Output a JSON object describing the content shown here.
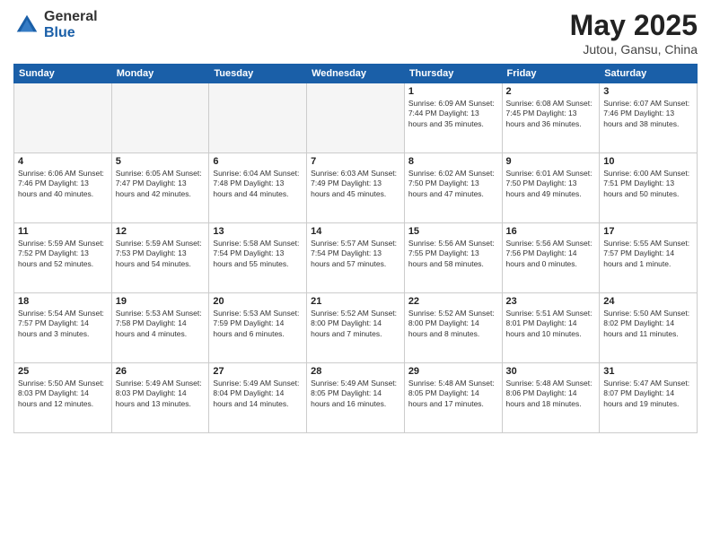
{
  "header": {
    "logo_general": "General",
    "logo_blue": "Blue",
    "month_title": "May 2025",
    "location": "Jutou, Gansu, China"
  },
  "days_of_week": [
    "Sunday",
    "Monday",
    "Tuesday",
    "Wednesday",
    "Thursday",
    "Friday",
    "Saturday"
  ],
  "weeks": [
    [
      {
        "day": "",
        "info": ""
      },
      {
        "day": "",
        "info": ""
      },
      {
        "day": "",
        "info": ""
      },
      {
        "day": "",
        "info": ""
      },
      {
        "day": "1",
        "info": "Sunrise: 6:09 AM\nSunset: 7:44 PM\nDaylight: 13 hours\nand 35 minutes."
      },
      {
        "day": "2",
        "info": "Sunrise: 6:08 AM\nSunset: 7:45 PM\nDaylight: 13 hours\nand 36 minutes."
      },
      {
        "day": "3",
        "info": "Sunrise: 6:07 AM\nSunset: 7:46 PM\nDaylight: 13 hours\nand 38 minutes."
      }
    ],
    [
      {
        "day": "4",
        "info": "Sunrise: 6:06 AM\nSunset: 7:46 PM\nDaylight: 13 hours\nand 40 minutes."
      },
      {
        "day": "5",
        "info": "Sunrise: 6:05 AM\nSunset: 7:47 PM\nDaylight: 13 hours\nand 42 minutes."
      },
      {
        "day": "6",
        "info": "Sunrise: 6:04 AM\nSunset: 7:48 PM\nDaylight: 13 hours\nand 44 minutes."
      },
      {
        "day": "7",
        "info": "Sunrise: 6:03 AM\nSunset: 7:49 PM\nDaylight: 13 hours\nand 45 minutes."
      },
      {
        "day": "8",
        "info": "Sunrise: 6:02 AM\nSunset: 7:50 PM\nDaylight: 13 hours\nand 47 minutes."
      },
      {
        "day": "9",
        "info": "Sunrise: 6:01 AM\nSunset: 7:50 PM\nDaylight: 13 hours\nand 49 minutes."
      },
      {
        "day": "10",
        "info": "Sunrise: 6:00 AM\nSunset: 7:51 PM\nDaylight: 13 hours\nand 50 minutes."
      }
    ],
    [
      {
        "day": "11",
        "info": "Sunrise: 5:59 AM\nSunset: 7:52 PM\nDaylight: 13 hours\nand 52 minutes."
      },
      {
        "day": "12",
        "info": "Sunrise: 5:59 AM\nSunset: 7:53 PM\nDaylight: 13 hours\nand 54 minutes."
      },
      {
        "day": "13",
        "info": "Sunrise: 5:58 AM\nSunset: 7:54 PM\nDaylight: 13 hours\nand 55 minutes."
      },
      {
        "day": "14",
        "info": "Sunrise: 5:57 AM\nSunset: 7:54 PM\nDaylight: 13 hours\nand 57 minutes."
      },
      {
        "day": "15",
        "info": "Sunrise: 5:56 AM\nSunset: 7:55 PM\nDaylight: 13 hours\nand 58 minutes."
      },
      {
        "day": "16",
        "info": "Sunrise: 5:56 AM\nSunset: 7:56 PM\nDaylight: 14 hours\nand 0 minutes."
      },
      {
        "day": "17",
        "info": "Sunrise: 5:55 AM\nSunset: 7:57 PM\nDaylight: 14 hours\nand 1 minute."
      }
    ],
    [
      {
        "day": "18",
        "info": "Sunrise: 5:54 AM\nSunset: 7:57 PM\nDaylight: 14 hours\nand 3 minutes."
      },
      {
        "day": "19",
        "info": "Sunrise: 5:53 AM\nSunset: 7:58 PM\nDaylight: 14 hours\nand 4 minutes."
      },
      {
        "day": "20",
        "info": "Sunrise: 5:53 AM\nSunset: 7:59 PM\nDaylight: 14 hours\nand 6 minutes."
      },
      {
        "day": "21",
        "info": "Sunrise: 5:52 AM\nSunset: 8:00 PM\nDaylight: 14 hours\nand 7 minutes."
      },
      {
        "day": "22",
        "info": "Sunrise: 5:52 AM\nSunset: 8:00 PM\nDaylight: 14 hours\nand 8 minutes."
      },
      {
        "day": "23",
        "info": "Sunrise: 5:51 AM\nSunset: 8:01 PM\nDaylight: 14 hours\nand 10 minutes."
      },
      {
        "day": "24",
        "info": "Sunrise: 5:50 AM\nSunset: 8:02 PM\nDaylight: 14 hours\nand 11 minutes."
      }
    ],
    [
      {
        "day": "25",
        "info": "Sunrise: 5:50 AM\nSunset: 8:03 PM\nDaylight: 14 hours\nand 12 minutes."
      },
      {
        "day": "26",
        "info": "Sunrise: 5:49 AM\nSunset: 8:03 PM\nDaylight: 14 hours\nand 13 minutes."
      },
      {
        "day": "27",
        "info": "Sunrise: 5:49 AM\nSunset: 8:04 PM\nDaylight: 14 hours\nand 14 minutes."
      },
      {
        "day": "28",
        "info": "Sunrise: 5:49 AM\nSunset: 8:05 PM\nDaylight: 14 hours\nand 16 minutes."
      },
      {
        "day": "29",
        "info": "Sunrise: 5:48 AM\nSunset: 8:05 PM\nDaylight: 14 hours\nand 17 minutes."
      },
      {
        "day": "30",
        "info": "Sunrise: 5:48 AM\nSunset: 8:06 PM\nDaylight: 14 hours\nand 18 minutes."
      },
      {
        "day": "31",
        "info": "Sunrise: 5:47 AM\nSunset: 8:07 PM\nDaylight: 14 hours\nand 19 minutes."
      }
    ]
  ]
}
